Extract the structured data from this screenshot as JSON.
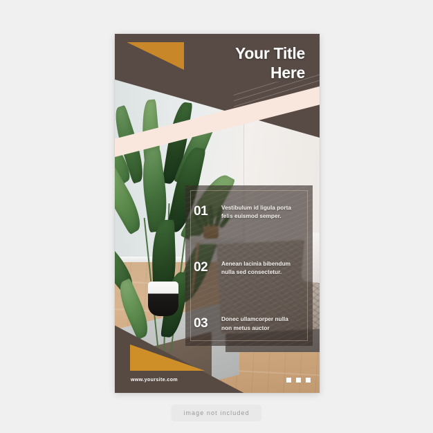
{
  "page": {
    "background_color": "#f0f0f0",
    "not_included_label": "image not included"
  },
  "mockup": {
    "title_line1": "Your Title",
    "title_line2": "Here",
    "site_url": "www.yoursite.com",
    "colors": {
      "brown": "#584b45",
      "gold": "#c8882a",
      "blush": "#f9e7de",
      "panel_overlay": "rgba(52,42,37,0.62)",
      "text_white": "#ffffff"
    },
    "panel": {
      "items": [
        {
          "number": "01",
          "text": "Vestibulum id ligula porta felis euismod semper."
        },
        {
          "number": "02",
          "text": "Aenean lacinia bibendum nulla sed consectetur."
        },
        {
          "number": "03",
          "text": "Donec ullamcorper nulla non metus auctor"
        }
      ]
    },
    "pagination": {
      "dots": 3
    }
  }
}
